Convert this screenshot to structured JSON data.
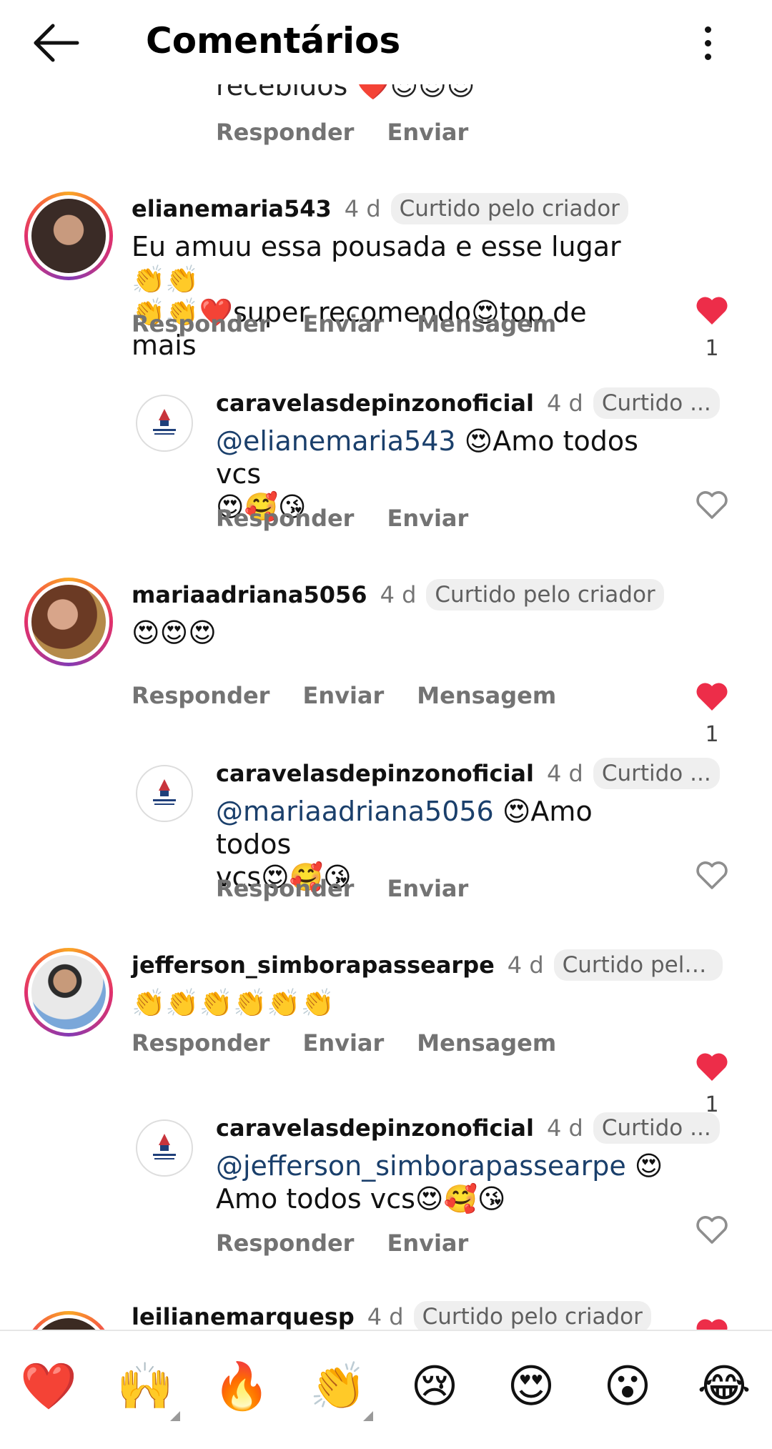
{
  "header": {
    "title": "Comentários"
  },
  "top_partial": {
    "text": "recebidos ❤️😍😍😍",
    "actions": [
      "Responder",
      "Enviar"
    ]
  },
  "comments": [
    {
      "username": "elianemaria543",
      "time": "4 d",
      "badge": "Curtido pelo criador",
      "text_line1": "Eu amuu essa pousada e esse lugar👏👏",
      "text_line2": "👏👏❤️super recomendo😍top de mais",
      "actions": [
        "Responder",
        "Enviar",
        "Mensagem"
      ],
      "like_count": "1"
    },
    {
      "username": "caravelasdepinzonoficial",
      "time": "4 d",
      "badge": "Curtido ...",
      "mention": "@elianemaria543",
      "text_line1": " 😍Amo todos vcs",
      "text_line2": "😍🥰😘",
      "actions": [
        "Responder",
        "Enviar"
      ]
    },
    {
      "username": "mariaadriana5056",
      "time": "4 d",
      "badge": "Curtido pelo criador",
      "text_line1": "😍😍😍",
      "actions": [
        "Responder",
        "Enviar",
        "Mensagem"
      ],
      "like_count": "1"
    },
    {
      "username": "caravelasdepinzonoficial",
      "time": "4 d",
      "badge": "Curtido ...",
      "mention": "@mariaadriana5056",
      "text_line1": " 😍Amo todos",
      "text_line2": "vcs😍🥰😘",
      "actions": [
        "Responder",
        "Enviar"
      ]
    },
    {
      "username": "jefferson_simborapassearpe",
      "time": "4 d",
      "badge": "Curtido pelo ...",
      "text_line1": "👏👏👏👏👏👏",
      "actions": [
        "Responder",
        "Enviar",
        "Mensagem"
      ],
      "like_count": "1"
    },
    {
      "username": "caravelasdepinzonoficial",
      "time": "4 d",
      "badge": "Curtido ...",
      "mention": "@jefferson_simborapassearpe",
      "text_line1": " 😍",
      "text_line2": "Amo todos vcs😍🥰😘",
      "actions": [
        "Responder",
        "Enviar"
      ]
    },
    {
      "username": "leilianemarquesp",
      "time": "4 d",
      "badge": "Curtido pelo criador"
    }
  ],
  "emoji_bar": [
    "❤️",
    "🙌",
    "🔥",
    "👏",
    "😢",
    "😍",
    "😮",
    "😂"
  ],
  "colors": {
    "like_red": "#ed2d49",
    "brand_ring": "#e1306c",
    "mention": "#1a3f6b"
  }
}
